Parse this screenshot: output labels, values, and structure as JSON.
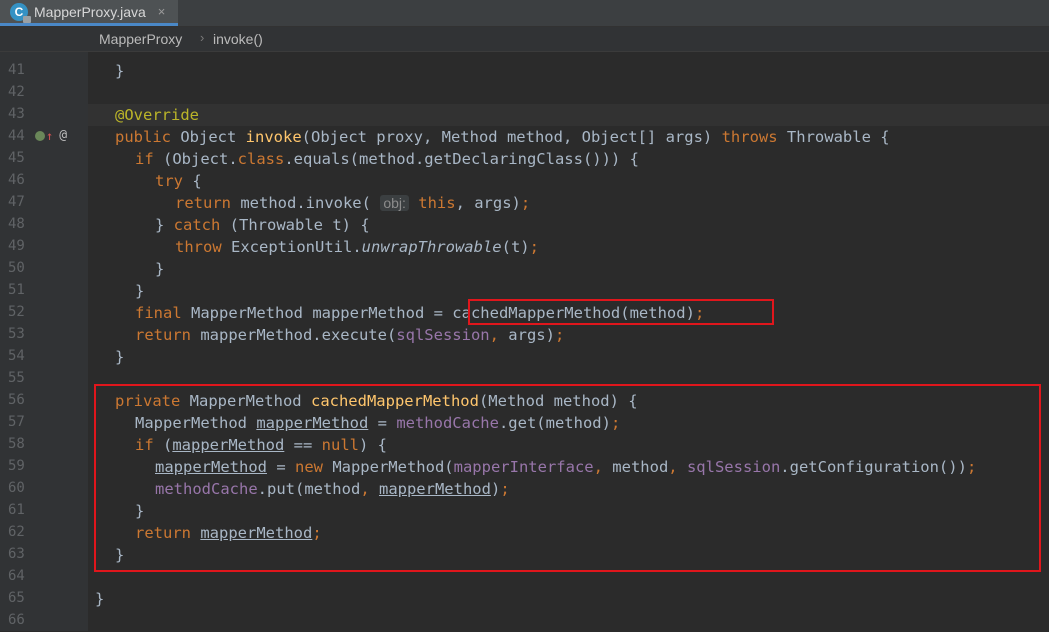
{
  "tab": {
    "icon_letter": "C",
    "label": "MapperProxy.java",
    "close": "×"
  },
  "breadcrumb": {
    "items": [
      "MapperProxy",
      "invoke()"
    ],
    "separator": "›"
  },
  "editor": {
    "current_line": 43,
    "lines": [
      {
        "n": "41",
        "indent": 1,
        "tokens": [
          {
            "t": "}"
          }
        ]
      },
      {
        "n": "42",
        "indent": 0,
        "tokens": []
      },
      {
        "n": "43",
        "indent": 1,
        "tokens": [
          {
            "t": "@Override",
            "c": "a"
          }
        ]
      },
      {
        "n": "44",
        "indent": 1,
        "tokens": [
          {
            "t": "public ",
            "c": "k"
          },
          {
            "t": "Object "
          },
          {
            "t": "invoke",
            "c": "f"
          },
          {
            "t": "(Object proxy, Method method, Object[] args) "
          },
          {
            "t": "throws ",
            "c": "k"
          },
          {
            "t": "Throwable {"
          }
        ]
      },
      {
        "n": "45",
        "indent": 2,
        "tokens": [
          {
            "t": "if ",
            "c": "k"
          },
          {
            "t": "(Object."
          },
          {
            "t": "class",
            "c": "k"
          },
          {
            "t": ".equals(method.getDeclaringClass())) {"
          }
        ]
      },
      {
        "n": "46",
        "indent": 3,
        "tokens": [
          {
            "t": "try ",
            "c": "k"
          },
          {
            "t": "{"
          }
        ]
      },
      {
        "n": "47",
        "indent": 4,
        "tokens": [
          {
            "t": "return ",
            "c": "k"
          },
          {
            "t": "method.invoke( "
          },
          {
            "t": "obj:",
            "c": "hint"
          },
          {
            "t": " "
          },
          {
            "t": "this",
            "c": "k"
          },
          {
            "t": ", args)"
          },
          {
            "t": ";",
            "c": "k"
          }
        ]
      },
      {
        "n": "48",
        "indent": 3,
        "tokens": [
          {
            "t": "} "
          },
          {
            "t": "catch ",
            "c": "k"
          },
          {
            "t": "(Throwable t) {"
          }
        ]
      },
      {
        "n": "49",
        "indent": 4,
        "tokens": [
          {
            "t": "throw ",
            "c": "k"
          },
          {
            "t": "ExceptionUtil."
          },
          {
            "t": "unwrapThrowable",
            "c": "i"
          },
          {
            "t": "(t)"
          },
          {
            "t": ";",
            "c": "k"
          }
        ]
      },
      {
        "n": "50",
        "indent": 3,
        "tokens": [
          {
            "t": "}"
          }
        ]
      },
      {
        "n": "51",
        "indent": 2,
        "tokens": [
          {
            "t": "}"
          }
        ]
      },
      {
        "n": "52",
        "indent": 2,
        "tokens": [
          {
            "t": "final ",
            "c": "k"
          },
          {
            "t": "MapperMethod mapperMethod = "
          },
          {
            "t": "cachedMapperMethod(method)"
          },
          {
            "t": ";",
            "c": "k"
          }
        ]
      },
      {
        "n": "53",
        "indent": 2,
        "tokens": [
          {
            "t": "return ",
            "c": "k"
          },
          {
            "t": "mapperMethod.execute("
          },
          {
            "t": "sqlSession",
            "c": "p"
          },
          {
            "t": ", ",
            "c": "k"
          },
          {
            "t": "args)"
          },
          {
            "t": ";",
            "c": "k"
          }
        ]
      },
      {
        "n": "54",
        "indent": 1,
        "tokens": [
          {
            "t": "}"
          }
        ]
      },
      {
        "n": "55",
        "indent": 0,
        "tokens": []
      },
      {
        "n": "56",
        "indent": 1,
        "tokens": [
          {
            "t": "private ",
            "c": "k"
          },
          {
            "t": "MapperMethod "
          },
          {
            "t": "cachedMapperMethod",
            "c": "f"
          },
          {
            "t": "(Method method) {"
          }
        ]
      },
      {
        "n": "57",
        "indent": 2,
        "tokens": [
          {
            "t": "MapperMethod "
          },
          {
            "t": "mapperMethod",
            "c": "u"
          },
          {
            "t": " = "
          },
          {
            "t": "methodCache",
            "c": "p"
          },
          {
            "t": ".get(method)"
          },
          {
            "t": ";",
            "c": "k"
          }
        ]
      },
      {
        "n": "58",
        "indent": 2,
        "tokens": [
          {
            "t": "if ",
            "c": "k"
          },
          {
            "t": "("
          },
          {
            "t": "mapperMethod",
            "c": "u"
          },
          {
            "t": " == "
          },
          {
            "t": "null",
            "c": "k"
          },
          {
            "t": ") {"
          }
        ]
      },
      {
        "n": "59",
        "indent": 3,
        "tokens": [
          {
            "t": "mapperMethod",
            "c": "u"
          },
          {
            "t": " = "
          },
          {
            "t": "new ",
            "c": "k"
          },
          {
            "t": "MapperMethod("
          },
          {
            "t": "mapperInterface",
            "c": "p"
          },
          {
            "t": ", ",
            "c": "k"
          },
          {
            "t": "method"
          },
          {
            "t": ", ",
            "c": "k"
          },
          {
            "t": "sqlSession",
            "c": "p"
          },
          {
            "t": ".getConfiguration())"
          },
          {
            "t": ";",
            "c": "k"
          }
        ]
      },
      {
        "n": "60",
        "indent": 3,
        "tokens": [
          {
            "t": "methodCache",
            "c": "p"
          },
          {
            "t": ".put(method"
          },
          {
            "t": ", ",
            "c": "k"
          },
          {
            "t": "mapperMethod",
            "c": "u"
          },
          {
            "t": ")"
          },
          {
            "t": ";",
            "c": "k"
          }
        ]
      },
      {
        "n": "61",
        "indent": 2,
        "tokens": [
          {
            "t": "}"
          }
        ]
      },
      {
        "n": "62",
        "indent": 2,
        "tokens": [
          {
            "t": "return ",
            "c": "k"
          },
          {
            "t": "mapperMethod",
            "c": "u"
          },
          {
            "t": ";",
            "c": "k"
          }
        ]
      },
      {
        "n": "63",
        "indent": 1,
        "tokens": [
          {
            "t": "}"
          }
        ]
      },
      {
        "n": "64",
        "indent": 0,
        "tokens": []
      },
      {
        "n": "65",
        "indent": 0,
        "tokens": [
          {
            "t": "}"
          }
        ]
      },
      {
        "n": "66",
        "indent": 0,
        "tokens": []
      }
    ]
  },
  "colors": {
    "keyword": "#cc7832",
    "function": "#ffc66d",
    "annotation": "#bbb529",
    "field": "#9876aa",
    "text": "#a9b7c6",
    "highlight_box": "#e0161c"
  }
}
